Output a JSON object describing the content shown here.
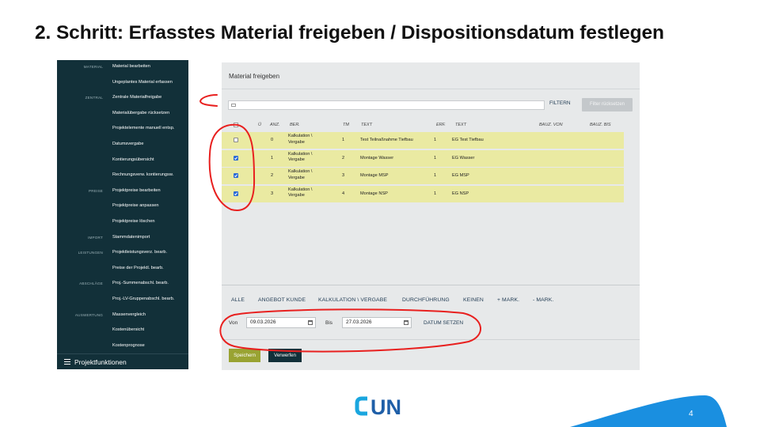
{
  "slide": {
    "title": "2. Schritt: Erfasstes Material freigeben / Dispositionsdatum festlegen",
    "page_number": "4"
  },
  "logo": {
    "text": "CUN",
    "color": "#1f5fa8",
    "accent": "#1aa6df"
  },
  "sidebar": {
    "rows": [
      {
        "section": "MATERIAL",
        "label": "Material bearbeiten"
      },
      {
        "section": "",
        "label": "Ungeplantes Material erfassen"
      },
      {
        "section": "ZENTRAL",
        "label": "Zentrale Materialfreigabe"
      },
      {
        "section": "",
        "label": "Materialübergabe rücksetzen"
      },
      {
        "section": "",
        "label": "Projektelemente manuell entsp."
      },
      {
        "section": "",
        "label": "Datumsvergabe"
      },
      {
        "section": "",
        "label": "Kontierungsübersicht"
      },
      {
        "section": "",
        "label": "Rechnungsverw. kontierungsw."
      },
      {
        "section": "PREISE",
        "label": "Projektpreise bearbeiten"
      },
      {
        "section": "",
        "label": "Projektpreise anpassen"
      },
      {
        "section": "",
        "label": "Projektpreise löschen"
      },
      {
        "section": "IMPORT",
        "label": "Stammdatenimport"
      },
      {
        "section": "LEISTUNGEN",
        "label": "Projektleistungsverz. bearb."
      },
      {
        "section": "",
        "label": "Preise der Projektl. bearb."
      },
      {
        "section": "ABSCHLÄGE",
        "label": "Proj.-Summenabschl. bearb."
      },
      {
        "section": "",
        "label": "Proj.-LV-Gruppenabschl. bearb."
      },
      {
        "section": "AUSWERTUNG",
        "label": "Massenvergleich"
      },
      {
        "section": "",
        "label": "Kostenübersicht"
      },
      {
        "section": "",
        "label": "Kostenprognose"
      }
    ],
    "bottom_label": "Projektfunktionen"
  },
  "panel": {
    "title": "Material freigeben",
    "filter_label": "FILTERN",
    "reset_label": "Filter rücksetzen",
    "headers": {
      "u": "Ü",
      "anz": "ANZ.",
      "ber": "BER.",
      "tm": "TM",
      "text": "TEXT",
      "erf": "ERF.",
      "text2": "TEXT",
      "bauz_von": "BAUZ. VON",
      "bauz_bis": "BAUZ. BIS"
    },
    "rows": [
      {
        "checked": false,
        "anz": "0",
        "ber": "Kalkulation \\ Vergabe",
        "tm": "1",
        "text": "Test Teilnaßnahme Tiefbau",
        "erf": "1",
        "text2": "EG Test Tiefbau"
      },
      {
        "checked": true,
        "anz": "1",
        "ber": "Kalkulation \\ Vergabe",
        "tm": "2",
        "text": "Montage Wasser",
        "erf": "1",
        "text2": "EG Wasser"
      },
      {
        "checked": true,
        "anz": "2",
        "ber": "Kalkulation \\ Vergabe",
        "tm": "3",
        "text": "Montage MSP",
        "erf": "1",
        "text2": "EG MSP"
      },
      {
        "checked": true,
        "anz": "3",
        "ber": "Kalkulation \\ Vergabe",
        "tm": "4",
        "text": "Montage NSP",
        "erf": "1",
        "text2": "EG NSP"
      }
    ],
    "selection": {
      "all": "ALLE",
      "offer": "ANGEBOT KUNDE",
      "calc": "KALKULATION \\ VERGABE",
      "exec": "DURCHFÜHRUNG",
      "none": "KEINEN",
      "plus": "+ MARK.",
      "minus": "- MARK."
    },
    "dates": {
      "from_label": "Von",
      "from_value": "09.03.2026",
      "to_label": "Bis",
      "to_value": "27.03.2026",
      "set_label": "DATUM SETZEN"
    },
    "save_label": "Speichern",
    "discard_label": "Verwerfen"
  },
  "colors": {
    "sidebar_bg": "#123039",
    "row_highlight": "#eaeaa2",
    "annotation": "#e8201f",
    "save_button": "#99a332",
    "footer_wave": "#1a8fe0"
  }
}
